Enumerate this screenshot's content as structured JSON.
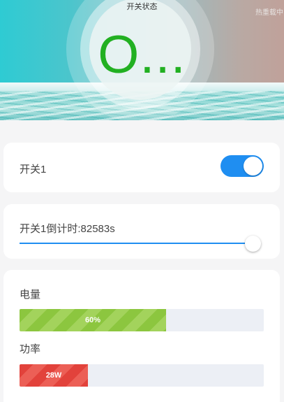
{
  "header": {
    "status_title": "开关状态",
    "status_value": "O...",
    "watermark": "热重载中"
  },
  "switch_card": {
    "label": "开关1",
    "toggle_on": true
  },
  "countdown_card": {
    "label": "开关1倒计时:82583s",
    "slider_fraction": 1.0
  },
  "meters_card": {
    "battery": {
      "label": "电量",
      "text": "60%",
      "percent": 60
    },
    "power": {
      "label": "功率",
      "text": "28W",
      "percent": 28
    }
  },
  "colors": {
    "accent": "#1f8ef1",
    "status_green": "#22b022",
    "battery_fill": "#8cc63f",
    "power_fill": "#e2423b"
  }
}
